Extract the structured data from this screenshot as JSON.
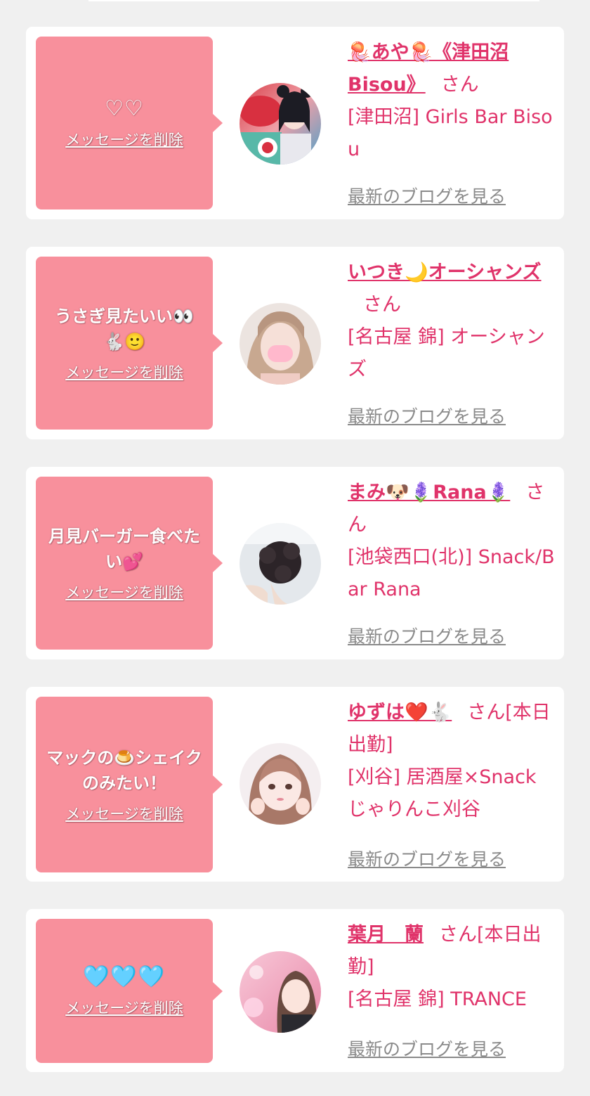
{
  "delete_label": "メッセージを削除",
  "blog_label": "最新のブログを見る",
  "san_label": "さん",
  "colors": {
    "page_bg": "#f0f0f0",
    "card_bg": "#ffffff",
    "bubble_pink": "#f8909c",
    "name_accent": "#e0336a",
    "blog_link_gray": "#8a8a8a"
  },
  "messages": [
    {
      "message": "♡♡",
      "name": "🪼あや🪼《津田沼Bisou》",
      "san_suffix": "さん",
      "shop": "[津田沼] Girls Bar Bisou",
      "avatar_icon": "avatar-photo-girl-party"
    },
    {
      "message": "うさぎ見たいい👀🐇🙂",
      "name": "いつき🌙オーシャンズ",
      "san_suffix": "さん",
      "shop": "[名古屋 錦] オーシャンズ",
      "avatar_icon": "avatar-photo-masked-girl"
    },
    {
      "message": "月見バーガー食べたい💕",
      "name": "まみ🐶🪻Rana🪻",
      "san_suffix": "さん",
      "shop": "[池袋西口(北)] Snack/Bar Rana",
      "avatar_icon": "avatar-photo-hairstyle"
    },
    {
      "message": "マックの🍮シェイクのみたい！",
      "name": "ゆずは❤️🐇",
      "san_suffix": "さん[本日出勤]",
      "shop": "[刈谷] 居酒屋×Snack じゃりんこ刈谷",
      "avatar_icon": "avatar-photo-girl-bangs"
    },
    {
      "message": "🩵🩵🩵",
      "name": "葉月　蘭",
      "san_suffix": "さん[本日出勤]",
      "shop": "[名古屋 錦] TRANCE",
      "avatar_icon": "avatar-photo-girl-pink"
    }
  ]
}
